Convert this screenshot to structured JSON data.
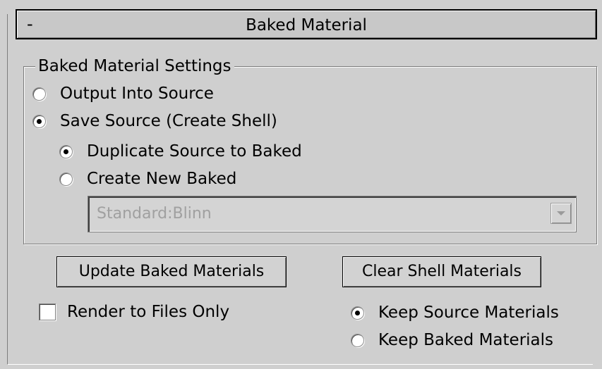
{
  "rollout": {
    "collapse_symbol": "-",
    "title": "Baked Material"
  },
  "settings_group": {
    "title": "Baked Material Settings",
    "output_into_source": "Output Into Source",
    "save_source": "Save Source (Create Shell)",
    "duplicate_source": "Duplicate Source to Baked",
    "create_new_baked": "Create New Baked",
    "material_type": "Standard:Blinn"
  },
  "buttons": {
    "update": "Update Baked Materials",
    "clear": "Clear Shell Materials"
  },
  "options": {
    "render_to_files_only": "Render to Files Only",
    "keep_source": "Keep Source Materials",
    "keep_baked": "Keep Baked Materials"
  },
  "state": {
    "output_mode": "save_source",
    "shell_mode": "duplicate",
    "render_to_files_only": false,
    "keep_mode": "keep_source"
  },
  "icons": {
    "dropdown": "chevron-down-icon"
  }
}
